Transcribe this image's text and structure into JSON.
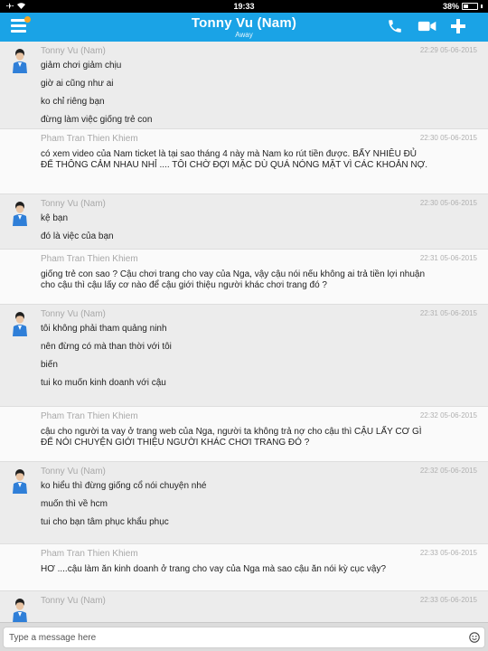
{
  "status": {
    "time": "19:33",
    "battery": "38%",
    "battery_level": 0.38
  },
  "header": {
    "title": "Tonny Vu (Nam)",
    "status": "Away"
  },
  "icons": {
    "menu": "menu-icon",
    "call": "phone-icon",
    "video": "video-camera-icon",
    "add": "plus-icon",
    "emoji": "emoji-icon"
  },
  "colors": {
    "brand": "#1aa3e6",
    "notification": "#f5a623"
  },
  "messages": [
    {
      "sender": "Tonny Vu (Nam)",
      "time": "22:29 05-06-2015",
      "lines": [
        "giảm chơi giảm chịu",
        "giờ ai cũng như ai",
        "ko chỉ riêng bạn",
        "đừng làm việc giống trẻ con"
      ]
    },
    {
      "sender": "Pham Tran Thien Khiem",
      "time": "22:30 05-06-2015",
      "lines": [
        "có xem video của Nam ticket là tại sao tháng 4 này mà Nam ko rút tiền được. BẤY NHIÊU ĐỦ",
        "ĐỂ THÔNG CẢM NHAU NHỈ .... TÔI CHỜ ĐỢI MẶC DÙ QUÁ NÓNG MẶT VÌ CÁC KHOẢN NỢ."
      ]
    },
    {
      "sender": "Tonny Vu (Nam)",
      "time": "22:30 05-06-2015",
      "lines": [
        "kệ bạn",
        "đó là việc của bạn"
      ]
    },
    {
      "sender": "Pham Tran Thien Khiem",
      "time": "22:31 05-06-2015",
      "lines": [
        "giống trẻ con sao ? Cậu chơi trang cho vay của Nga, vậy cậu nói nếu không ai trả tiền lợi nhuận",
        "cho cậu thì cậu lấy cơ nào để cậu giới thiệu người khác chơi trang đó ?"
      ]
    },
    {
      "sender": "Tonny Vu (Nam)",
      "time": "22:31 05-06-2015",
      "lines": [
        "tôi không phải tham quảng ninh",
        "nên đừng có mà than thời với tôi",
        "biến",
        "tui ko muốn kinh doanh với cậu"
      ]
    },
    {
      "sender": "Pham Tran Thien Khiem",
      "time": "22:32 05-06-2015",
      "lines": [
        "cậu cho người ta vay ở trang web của Nga, người ta không trả nợ cho cậu thì CẬU LẤY CƠ GÌ",
        "ĐỂ NÓI CHUYỆN GIỚI THIỆU NGƯỜI KHÁC CHƠI TRANG ĐÓ ?"
      ]
    },
    {
      "sender": "Tonny Vu (Nam)",
      "time": "22:32 05-06-2015",
      "lines": [
        "ko hiểu thì đừng giống cổ nói chuyện nhé",
        "muốn thì về hcm",
        "tui cho bạn tâm phục khẩu phục"
      ]
    },
    {
      "sender": "Pham Tran Thien Khiem",
      "time": "22:33 05-06-2015",
      "lines": [
        "HƠ ....cậu làm ăn kinh doanh ở trang cho vay của Nga mà sao cậu ăn nói kỳ cục vậy?"
      ]
    },
    {
      "sender": "Tonny Vu (Nam)",
      "time": "22:33 05-06-2015",
      "lines": []
    }
  ],
  "composer": {
    "placeholder": "Type a message here",
    "value": ""
  }
}
